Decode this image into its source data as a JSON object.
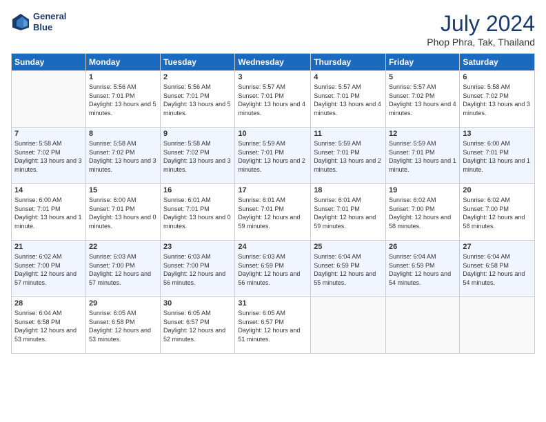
{
  "header": {
    "logo_line1": "General",
    "logo_line2": "Blue",
    "month_title": "July 2024",
    "location": "Phop Phra, Tak, Thailand"
  },
  "days_of_week": [
    "Sunday",
    "Monday",
    "Tuesday",
    "Wednesday",
    "Thursday",
    "Friday",
    "Saturday"
  ],
  "weeks": [
    [
      {
        "day": "",
        "sunrise": "",
        "sunset": "",
        "daylight": ""
      },
      {
        "day": "1",
        "sunrise": "Sunrise: 5:56 AM",
        "sunset": "Sunset: 7:01 PM",
        "daylight": "Daylight: 13 hours and 5 minutes."
      },
      {
        "day": "2",
        "sunrise": "Sunrise: 5:56 AM",
        "sunset": "Sunset: 7:01 PM",
        "daylight": "Daylight: 13 hours and 5 minutes."
      },
      {
        "day": "3",
        "sunrise": "Sunrise: 5:57 AM",
        "sunset": "Sunset: 7:01 PM",
        "daylight": "Daylight: 13 hours and 4 minutes."
      },
      {
        "day": "4",
        "sunrise": "Sunrise: 5:57 AM",
        "sunset": "Sunset: 7:01 PM",
        "daylight": "Daylight: 13 hours and 4 minutes."
      },
      {
        "day": "5",
        "sunrise": "Sunrise: 5:57 AM",
        "sunset": "Sunset: 7:02 PM",
        "daylight": "Daylight: 13 hours and 4 minutes."
      },
      {
        "day": "6",
        "sunrise": "Sunrise: 5:58 AM",
        "sunset": "Sunset: 7:02 PM",
        "daylight": "Daylight: 13 hours and 3 minutes."
      }
    ],
    [
      {
        "day": "7",
        "sunrise": "Sunrise: 5:58 AM",
        "sunset": "Sunset: 7:02 PM",
        "daylight": "Daylight: 13 hours and 3 minutes."
      },
      {
        "day": "8",
        "sunrise": "Sunrise: 5:58 AM",
        "sunset": "Sunset: 7:02 PM",
        "daylight": "Daylight: 13 hours and 3 minutes."
      },
      {
        "day": "9",
        "sunrise": "Sunrise: 5:58 AM",
        "sunset": "Sunset: 7:02 PM",
        "daylight": "Daylight: 13 hours and 3 minutes."
      },
      {
        "day": "10",
        "sunrise": "Sunrise: 5:59 AM",
        "sunset": "Sunset: 7:01 PM",
        "daylight": "Daylight: 13 hours and 2 minutes."
      },
      {
        "day": "11",
        "sunrise": "Sunrise: 5:59 AM",
        "sunset": "Sunset: 7:01 PM",
        "daylight": "Daylight: 13 hours and 2 minutes."
      },
      {
        "day": "12",
        "sunrise": "Sunrise: 5:59 AM",
        "sunset": "Sunset: 7:01 PM",
        "daylight": "Daylight: 13 hours and 1 minute."
      },
      {
        "day": "13",
        "sunrise": "Sunrise: 6:00 AM",
        "sunset": "Sunset: 7:01 PM",
        "daylight": "Daylight: 13 hours and 1 minute."
      }
    ],
    [
      {
        "day": "14",
        "sunrise": "Sunrise: 6:00 AM",
        "sunset": "Sunset: 7:01 PM",
        "daylight": "Daylight: 13 hours and 1 minute."
      },
      {
        "day": "15",
        "sunrise": "Sunrise: 6:00 AM",
        "sunset": "Sunset: 7:01 PM",
        "daylight": "Daylight: 13 hours and 0 minutes."
      },
      {
        "day": "16",
        "sunrise": "Sunrise: 6:01 AM",
        "sunset": "Sunset: 7:01 PM",
        "daylight": "Daylight: 13 hours and 0 minutes."
      },
      {
        "day": "17",
        "sunrise": "Sunrise: 6:01 AM",
        "sunset": "Sunset: 7:01 PM",
        "daylight": "Daylight: 12 hours and 59 minutes."
      },
      {
        "day": "18",
        "sunrise": "Sunrise: 6:01 AM",
        "sunset": "Sunset: 7:01 PM",
        "daylight": "Daylight: 12 hours and 59 minutes."
      },
      {
        "day": "19",
        "sunrise": "Sunrise: 6:02 AM",
        "sunset": "Sunset: 7:00 PM",
        "daylight": "Daylight: 12 hours and 58 minutes."
      },
      {
        "day": "20",
        "sunrise": "Sunrise: 6:02 AM",
        "sunset": "Sunset: 7:00 PM",
        "daylight": "Daylight: 12 hours and 58 minutes."
      }
    ],
    [
      {
        "day": "21",
        "sunrise": "Sunrise: 6:02 AM",
        "sunset": "Sunset: 7:00 PM",
        "daylight": "Daylight: 12 hours and 57 minutes."
      },
      {
        "day": "22",
        "sunrise": "Sunrise: 6:03 AM",
        "sunset": "Sunset: 7:00 PM",
        "daylight": "Daylight: 12 hours and 57 minutes."
      },
      {
        "day": "23",
        "sunrise": "Sunrise: 6:03 AM",
        "sunset": "Sunset: 7:00 PM",
        "daylight": "Daylight: 12 hours and 56 minutes."
      },
      {
        "day": "24",
        "sunrise": "Sunrise: 6:03 AM",
        "sunset": "Sunset: 6:59 PM",
        "daylight": "Daylight: 12 hours and 56 minutes."
      },
      {
        "day": "25",
        "sunrise": "Sunrise: 6:04 AM",
        "sunset": "Sunset: 6:59 PM",
        "daylight": "Daylight: 12 hours and 55 minutes."
      },
      {
        "day": "26",
        "sunrise": "Sunrise: 6:04 AM",
        "sunset": "Sunset: 6:59 PM",
        "daylight": "Daylight: 12 hours and 54 minutes."
      },
      {
        "day": "27",
        "sunrise": "Sunrise: 6:04 AM",
        "sunset": "Sunset: 6:58 PM",
        "daylight": "Daylight: 12 hours and 54 minutes."
      }
    ],
    [
      {
        "day": "28",
        "sunrise": "Sunrise: 6:04 AM",
        "sunset": "Sunset: 6:58 PM",
        "daylight": "Daylight: 12 hours and 53 minutes."
      },
      {
        "day": "29",
        "sunrise": "Sunrise: 6:05 AM",
        "sunset": "Sunset: 6:58 PM",
        "daylight": "Daylight: 12 hours and 53 minutes."
      },
      {
        "day": "30",
        "sunrise": "Sunrise: 6:05 AM",
        "sunset": "Sunset: 6:57 PM",
        "daylight": "Daylight: 12 hours and 52 minutes."
      },
      {
        "day": "31",
        "sunrise": "Sunrise: 6:05 AM",
        "sunset": "Sunset: 6:57 PM",
        "daylight": "Daylight: 12 hours and 51 minutes."
      },
      {
        "day": "",
        "sunrise": "",
        "sunset": "",
        "daylight": ""
      },
      {
        "day": "",
        "sunrise": "",
        "sunset": "",
        "daylight": ""
      },
      {
        "day": "",
        "sunrise": "",
        "sunset": "",
        "daylight": ""
      }
    ]
  ]
}
